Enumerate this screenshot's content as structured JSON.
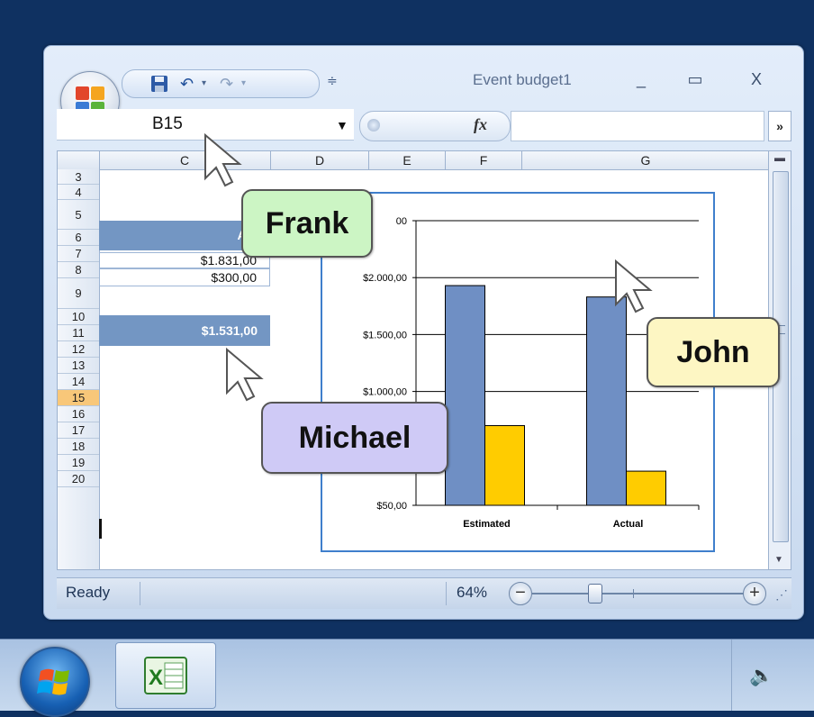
{
  "window": {
    "title": "Event budget1",
    "minimize": "_",
    "maximize": "▭",
    "close": "X"
  },
  "formula_bar": {
    "name_box": "B15",
    "fx": "fx",
    "expand": "»"
  },
  "columns": [
    "C",
    "D",
    "E",
    "F",
    "G"
  ],
  "rows": [
    "3",
    "4",
    "5",
    "6",
    "7",
    "8",
    "9",
    "10",
    "11",
    "12",
    "13",
    "14",
    "15",
    "16",
    "17",
    "18",
    "19",
    "20"
  ],
  "selected_row": "15",
  "cells": {
    "c5": "Act",
    "c6": "$1.831,00",
    "c7": "$300,00",
    "c9": "$1.531,00"
  },
  "chart_data": {
    "type": "bar",
    "categories": [
      "Estimated",
      "Actual"
    ],
    "series": [
      {
        "values": [
          1930,
          1830
        ],
        "color": "#6f8fc4"
      },
      {
        "values": [
          700,
          300
        ],
        "color": "#ffcc00"
      }
    ],
    "ylim": [
      0,
      2500
    ],
    "ytick_labels": [
      "$50,00",
      "$1.000,00",
      "$1.500,00",
      "$2.000,00",
      "00"
    ],
    "ytick_values": [
      0,
      1000,
      1500,
      2000,
      2500
    ],
    "grid": true
  },
  "status_bar": {
    "ready": "Ready",
    "zoom": "64%",
    "zoom_out": "−",
    "zoom_in": "+"
  },
  "collaborators": [
    {
      "name": "Frank",
      "color": "#ccf5c4"
    },
    {
      "name": "John",
      "color": "#fdf6c3"
    },
    {
      "name": "Michael",
      "color": "#cfcaf6"
    }
  ],
  "taskbar": {
    "excel_icon": "excel-icon",
    "speaker": "🔈"
  }
}
